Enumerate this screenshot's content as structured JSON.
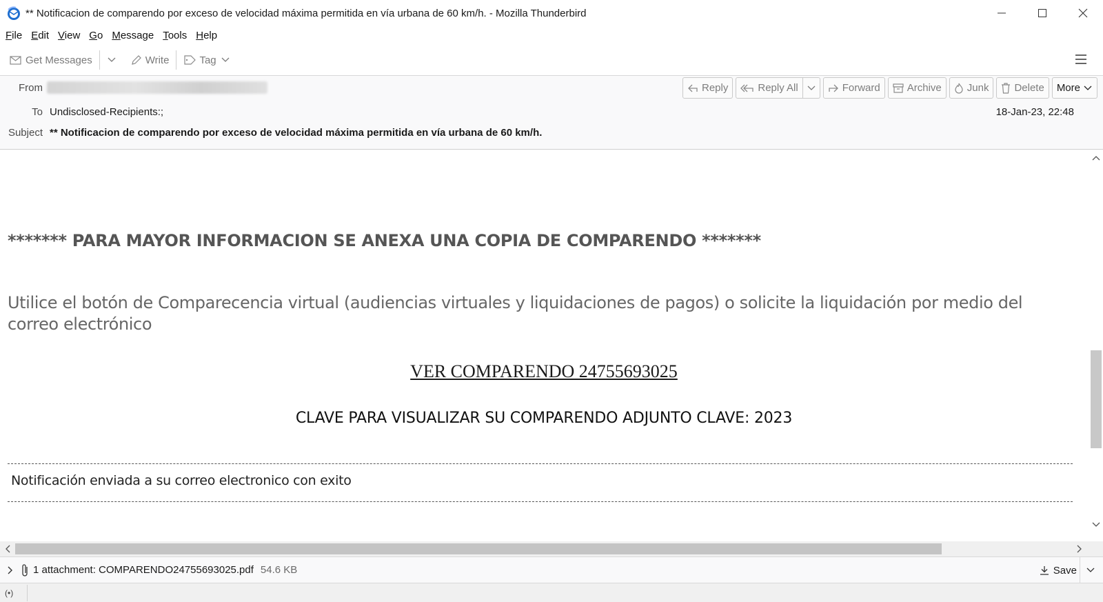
{
  "window": {
    "title": "** Notificacion de comparendo por exceso de velocidad máxima permitida en vía urbana de 60 km/h. - Mozilla Thunderbird"
  },
  "menu": {
    "items": [
      {
        "pre": "",
        "u": "F",
        "post": "ile"
      },
      {
        "pre": "",
        "u": "E",
        "post": "dit"
      },
      {
        "pre": "",
        "u": "V",
        "post": "iew"
      },
      {
        "pre": "",
        "u": "G",
        "post": "o"
      },
      {
        "pre": "",
        "u": "M",
        "post": "essage"
      },
      {
        "pre": "",
        "u": "T",
        "post": "ools"
      },
      {
        "pre": "",
        "u": "H",
        "post": "elp"
      }
    ]
  },
  "toolbar": {
    "get_messages": "Get Messages",
    "write": "Write",
    "tag": "Tag"
  },
  "header": {
    "from_label": "From",
    "to_label": "To",
    "to_value": "Undisclosed-Recipients:;",
    "subject_label": "Subject",
    "subject_value": "** Notificacion de comparendo por exceso de velocidad máxima permitida en vía urbana de 60 km/h.",
    "date": "18-Jan-23, 22:48",
    "actions": {
      "reply": "Reply",
      "reply_all": "Reply All",
      "forward": "Forward",
      "archive": "Archive",
      "junk": "Junk",
      "delete": "Delete",
      "more": "More"
    }
  },
  "body": {
    "banner": "******* PARA MAYOR INFORMACION SE ANEXA UNA COPIA DE COMPARENDO *******",
    "lead": "Utilice el botón de Comparecencia virtual (audiencias virtuales y liquidaciones de pagos) o solicite la liquidación por medio del correo electrónico",
    "link": "VER COMPARENDO 24755693025",
    "clave": "CLAVE PARA VISUALIZAR SU COMPARENDO ADJUNTO CLAVE:  2023",
    "notification": "Notificación enviada a su correo electronico con exito"
  },
  "attachments": {
    "label": "1 attachment: COMPARENDO24755693025.pdf",
    "size": "54.6 KB",
    "save": "Save"
  },
  "status": {
    "icon": "(•)"
  },
  "colors": {
    "accent": "#0a84ff",
    "muted_text": "#7a7a7a",
    "header_bg": "#f9f9fa"
  },
  "icons": [
    "thunderbird-logo-icon",
    "minimize-icon",
    "maximize-icon",
    "close-icon",
    "envelope-icon",
    "chevron-down-icon",
    "pencil-icon",
    "tag-icon",
    "hamburger-menu-icon",
    "reply-icon",
    "reply-all-icon",
    "forward-icon",
    "archive-icon",
    "junk-icon",
    "trash-icon",
    "paperclip-icon",
    "download-icon",
    "wifi-status-icon"
  ]
}
